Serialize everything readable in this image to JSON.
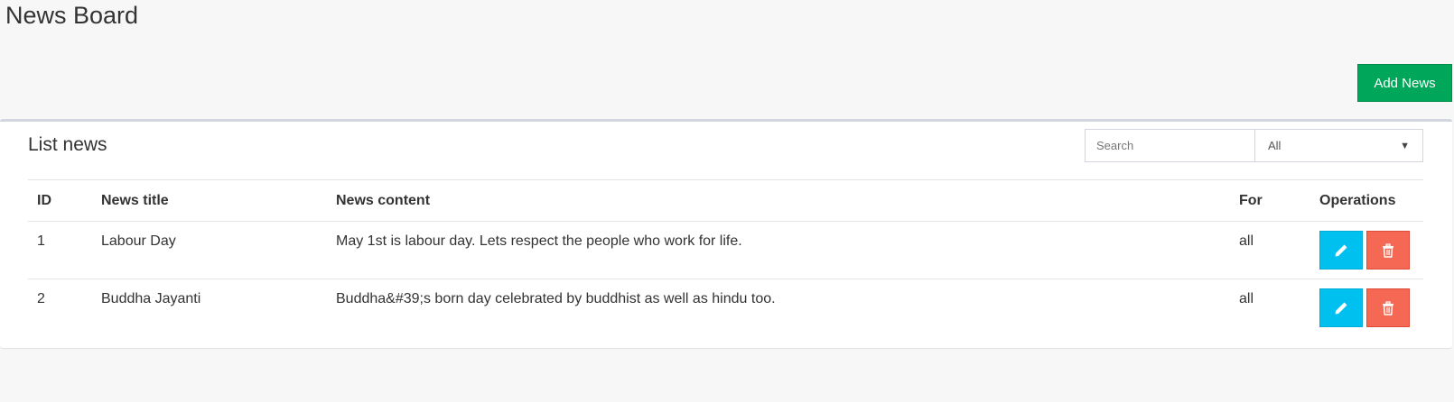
{
  "page": {
    "title": "News Board"
  },
  "toolbar": {
    "add_label": "Add News"
  },
  "box": {
    "title": "List news",
    "search": {
      "placeholder": "Search",
      "value": ""
    },
    "filter": {
      "selected": "All"
    }
  },
  "table": {
    "headers": {
      "id": "ID",
      "title": "News title",
      "content": "News content",
      "for": "For",
      "ops": "Operations"
    },
    "rows": [
      {
        "id": "1",
        "title": "Labour Day",
        "content": "May 1st is labour day. Lets respect the people who work for life.",
        "for": "all"
      },
      {
        "id": "2",
        "title": "Buddha Jayanti",
        "content": "Buddha&#39;s born day celebrated by buddhist as well as hindu too.",
        "for": "all"
      }
    ]
  },
  "colors": {
    "add_button": "#00a65a",
    "edit_button": "#00c0ef",
    "delete_button": "#f56954"
  },
  "icons": {
    "edit": "pencil-icon",
    "delete": "trash-icon"
  }
}
